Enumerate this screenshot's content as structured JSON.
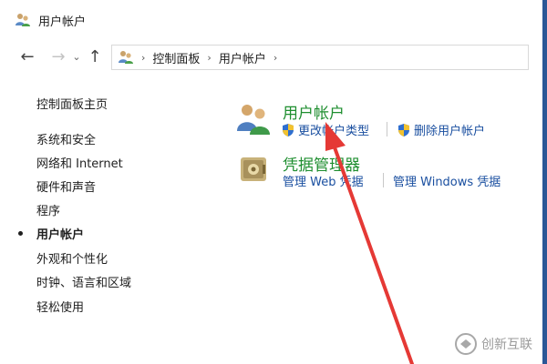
{
  "window": {
    "title": "用户帐户"
  },
  "nav": {
    "back_glyph": "←",
    "forward_glyph": "→",
    "recent_glyph": "⌄",
    "up_glyph": "↑"
  },
  "breadcrumb": {
    "sep": "›",
    "items": [
      "控制面板",
      "用户帐户"
    ]
  },
  "sidebar": {
    "home": "控制面板主页",
    "items": [
      {
        "label": "系统和安全"
      },
      {
        "label": "网络和 Internet"
      },
      {
        "label": "硬件和声音"
      },
      {
        "label": "程序"
      },
      {
        "label": "用户帐户",
        "current": true
      },
      {
        "label": "外观和个性化"
      },
      {
        "label": "时钟、语言和区域"
      },
      {
        "label": "轻松使用"
      }
    ]
  },
  "main": {
    "user_accounts": {
      "title": "用户帐户",
      "links": [
        "更改帐户类型",
        "删除用户帐户"
      ]
    },
    "credential_manager": {
      "title": "凭据管理器",
      "links": [
        "管理 Web 凭据",
        "管理 Windows 凭据"
      ]
    }
  },
  "watermark": {
    "text": "创新互联"
  },
  "colors": {
    "section_title": "#1e8e2f",
    "link": "#1a4fa0",
    "arrow": "#e53935",
    "accent_strip": "#2b5797"
  }
}
